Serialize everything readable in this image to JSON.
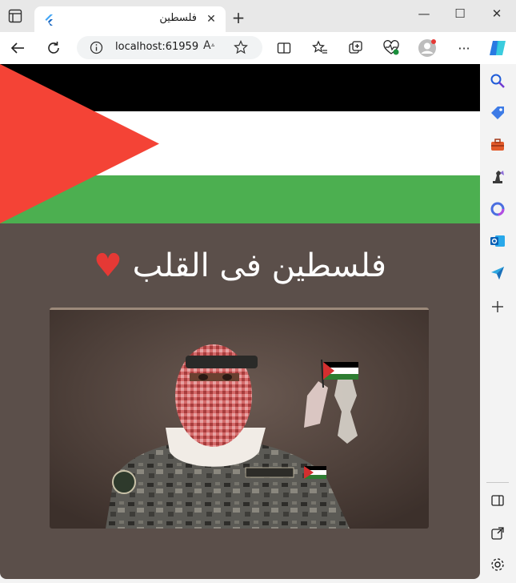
{
  "browser": {
    "tab_title": "فلسطين",
    "tab_close": "✕",
    "new_tab": "+",
    "url": "localhost:61959",
    "read_aloud": "A͆",
    "window_minimize": "—",
    "window_maximize": "☐",
    "window_close": "✕",
    "more": "···"
  },
  "page": {
    "heading": "فلسطين فى القلب",
    "heart": "♥",
    "flag_colors": {
      "black": "#000000",
      "white": "#ffffff",
      "green": "#4caf50",
      "red": "#f44336"
    },
    "background": "#5b4f4a"
  },
  "sidebar": {
    "items": [
      "search-icon",
      "tag-icon",
      "toolbox-icon",
      "chess-icon",
      "copilot-icon",
      "outlook-icon",
      "send-icon",
      "add-icon"
    ],
    "bottom": [
      "split-screen-icon",
      "open-external-icon",
      "settings-icon"
    ]
  }
}
